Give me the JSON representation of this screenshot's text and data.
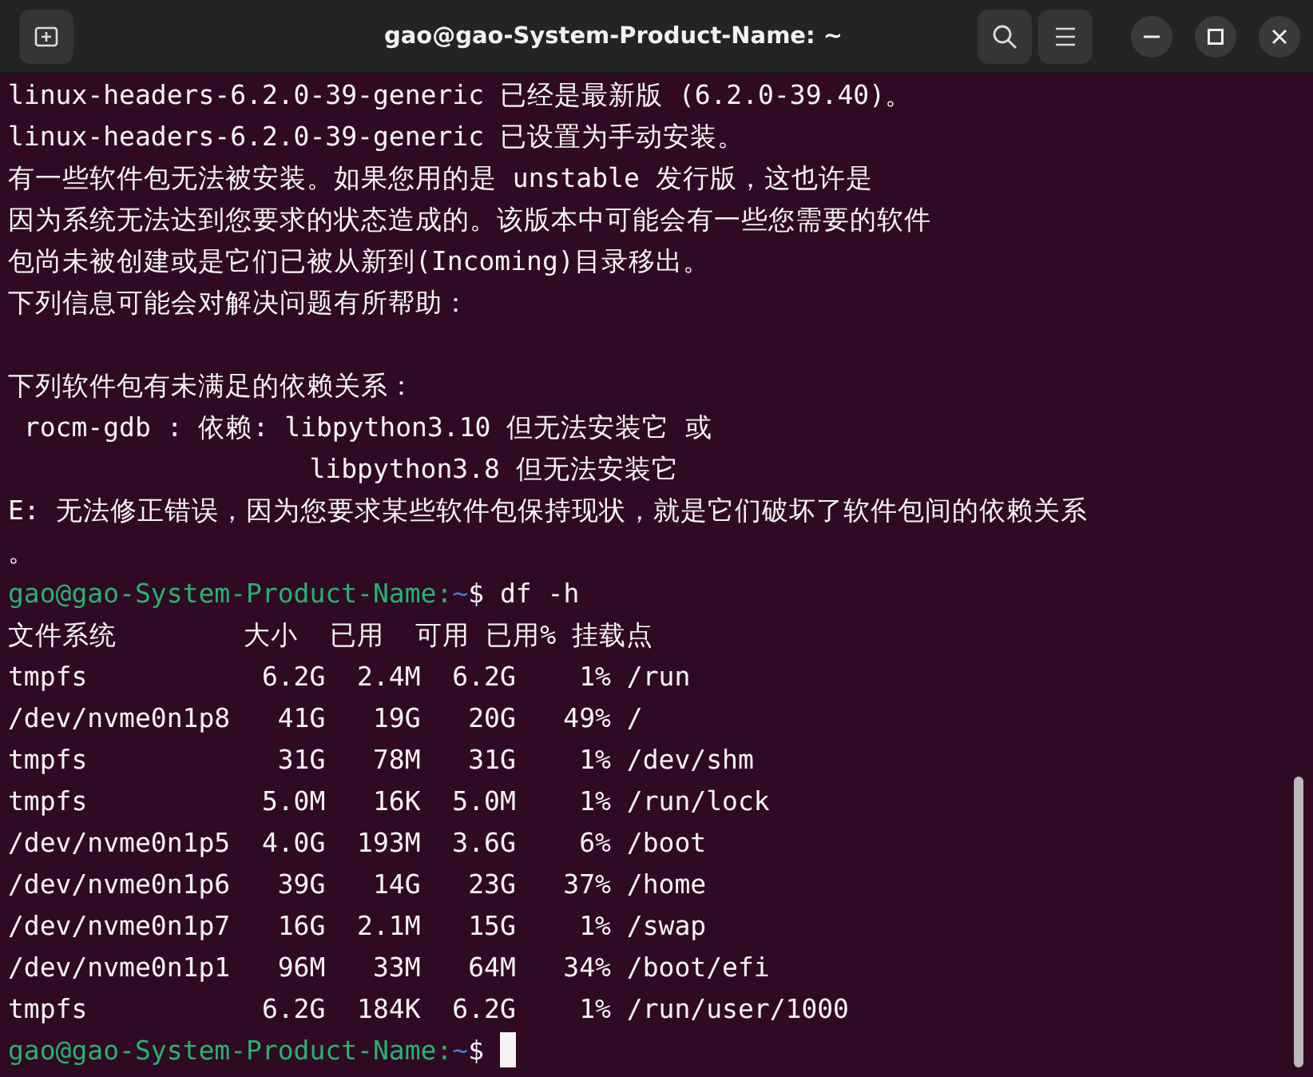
{
  "window": {
    "title": "gao@gao-System-Product-Name: ~"
  },
  "terminal": {
    "lines": [
      {
        "kind": "text",
        "text": "linux-headers-6.2.0-39-generic 已经是最新版 (6.2.0-39.40)。"
      },
      {
        "kind": "text",
        "text": "linux-headers-6.2.0-39-generic 已设置为手动安装。"
      },
      {
        "kind": "text",
        "text": "有一些软件包无法被安装。如果您用的是 unstable 发行版，这也许是"
      },
      {
        "kind": "text",
        "text": "因为系统无法达到您要求的状态造成的。该版本中可能会有一些您需要的软件"
      },
      {
        "kind": "text",
        "text": "包尚未被创建或是它们已被从新到(Incoming)目录移出。"
      },
      {
        "kind": "text",
        "text": "下列信息可能会对解决问题有所帮助："
      },
      {
        "kind": "blank"
      },
      {
        "kind": "text",
        "text": "下列软件包有未满足的依赖关系："
      },
      {
        "kind": "text",
        "text": " rocm-gdb : 依赖: libpython3.10 但无法安装它 或"
      },
      {
        "kind": "text",
        "text": "                   libpython3.8 但无法安装它"
      },
      {
        "kind": "text",
        "text": "E: 无法修正错误，因为您要求某些软件包保持现状，就是它们破坏了软件包间的依赖关系"
      },
      {
        "kind": "text",
        "text": "。"
      },
      {
        "kind": "prompt",
        "host": "gao@gao-System-Product-Name:",
        "path": "~",
        "command": "$ df -h",
        "cursor": false
      },
      {
        "kind": "text",
        "text": "文件系统        大小  已用  可用 已用% 挂载点"
      },
      {
        "kind": "text",
        "text": "tmpfs           6.2G  2.4M  6.2G    1% /run"
      },
      {
        "kind": "text",
        "text": "/dev/nvme0n1p8   41G   19G   20G   49% /"
      },
      {
        "kind": "text",
        "text": "tmpfs            31G   78M   31G    1% /dev/shm"
      },
      {
        "kind": "text",
        "text": "tmpfs           5.0M   16K  5.0M    1% /run/lock"
      },
      {
        "kind": "text",
        "text": "/dev/nvme0n1p5  4.0G  193M  3.6G    6% /boot"
      },
      {
        "kind": "text",
        "text": "/dev/nvme0n1p6   39G   14G   23G   37% /home"
      },
      {
        "kind": "text",
        "text": "/dev/nvme0n1p7   16G  2.1M   15G    1% /swap"
      },
      {
        "kind": "text",
        "text": "/dev/nvme0n1p1   96M   33M   64M   34% /boot/efi"
      },
      {
        "kind": "text",
        "text": "tmpfs           6.2G  184K  6.2G    1% /run/user/1000"
      },
      {
        "kind": "prompt",
        "host": "gao@gao-System-Product-Name:",
        "path": "~",
        "command": "$",
        "cursor": true
      }
    ]
  }
}
